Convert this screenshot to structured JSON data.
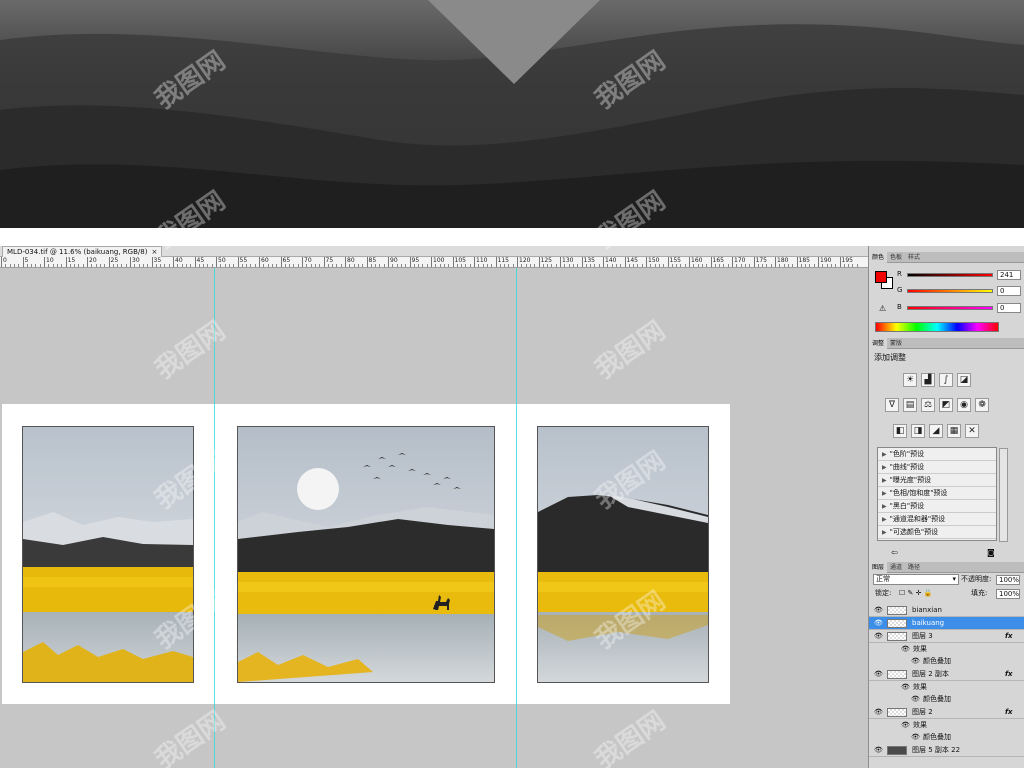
{
  "document": {
    "tab_title": "MLD-034.tif @ 11.6% (baikuang, RGB/8)",
    "tab_close": "×"
  },
  "ruler": {
    "labels": [
      "0",
      "5",
      "10",
      "15",
      "20",
      "25",
      "30",
      "35",
      "40",
      "45",
      "50",
      "55",
      "60",
      "65",
      "70",
      "75",
      "80",
      "85",
      "90",
      "95",
      "100",
      "105",
      "110",
      "115",
      "120",
      "125",
      "130",
      "135",
      "140",
      "145",
      "150",
      "155",
      "160",
      "165",
      "170",
      "175",
      "180",
      "185",
      "190",
      "195"
    ]
  },
  "watermark": {
    "text": "我图网"
  },
  "color_panel": {
    "tabs": [
      "颜色",
      "色板",
      "样式"
    ],
    "channels": [
      {
        "name": "R",
        "value": "241"
      },
      {
        "name": "G",
        "value": "0"
      },
      {
        "name": "B",
        "value": "0"
      }
    ],
    "foreground_color": "#f10000"
  },
  "adjust_panel": {
    "tabs": [
      "调整",
      "蒙版"
    ],
    "title": "添加调整",
    "presets": [
      "\"色阶\"预设",
      "\"曲线\"预设",
      "\"曝光度\"预设",
      "\"色相/饱和度\"预设",
      "\"黑白\"预设",
      "\"通道混和器\"预设",
      "\"可选颜色\"预设"
    ]
  },
  "layers_panel": {
    "tabs": [
      "图层",
      "通道",
      "路径"
    ],
    "blend_mode": "正常",
    "opacity_label": "不透明度:",
    "opacity_value": "100%",
    "lock_label": "锁定:",
    "fill_label": "填充:",
    "fill_value": "100%",
    "layers": [
      {
        "name": "bianxian"
      },
      {
        "name": "baikuang"
      },
      {
        "name": "图层 3",
        "fx": "fx"
      },
      {
        "name": "图层 2 副本",
        "fx": "fx"
      },
      {
        "name": "图层 2",
        "fx": "fx"
      },
      {
        "name": "图层 5 副本 22"
      }
    ],
    "effect_label": "效果",
    "overlay_label": "颜色叠加"
  }
}
